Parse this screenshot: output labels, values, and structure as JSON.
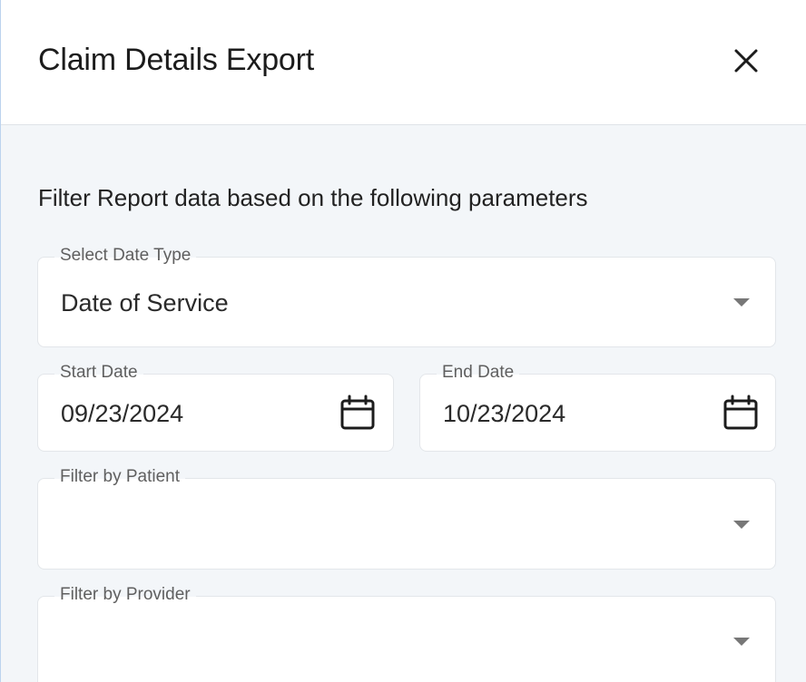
{
  "dialog": {
    "title": "Claim Details Export",
    "close_icon": "close-icon"
  },
  "form": {
    "subtitle": "Filter Report data based on the following parameters",
    "date_type": {
      "label": "Select Date Type",
      "value": "Date of Service",
      "icon": "dropdown-caret-icon"
    },
    "start_date": {
      "label": "Start Date",
      "value": "09/23/2024",
      "icon": "calendar-icon"
    },
    "end_date": {
      "label": "End Date",
      "value": "10/23/2024",
      "icon": "calendar-icon"
    },
    "patient": {
      "label": "Filter by Patient",
      "value": "",
      "icon": "dropdown-caret-icon"
    },
    "provider": {
      "label": "Filter by Provider",
      "value": "",
      "icon": "dropdown-caret-icon"
    }
  },
  "colors": {
    "header_bg": "#ffffff",
    "body_bg": "#f3f6f9",
    "field_border": "#e3e6ea",
    "label_text": "#5f5f5f",
    "caret": "#777777"
  }
}
